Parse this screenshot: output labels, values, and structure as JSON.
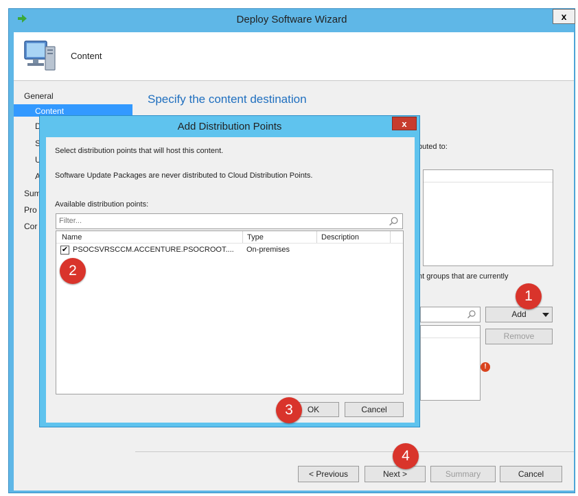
{
  "window": {
    "title": "Deploy Software Wizard",
    "close_label": "x",
    "header_title": "Content"
  },
  "nav": {
    "items": [
      {
        "label": "General"
      },
      {
        "label": "Content"
      },
      {
        "label": "D"
      },
      {
        "label": "S"
      },
      {
        "label": "U"
      },
      {
        "label": "A"
      },
      {
        "label": "Sum"
      },
      {
        "label": "Pro"
      },
      {
        "label": "Cor"
      }
    ]
  },
  "content": {
    "title": "Specify the content destination",
    "partial_text_1": "buted to:",
    "partial_text_2": "nt groups that are currently",
    "add_label": "Add",
    "remove_label": "Remove"
  },
  "footer": {
    "previous_label": "< Previous",
    "next_label": "Next >",
    "summary_label": "Summary",
    "cancel_label": "Cancel"
  },
  "dialog": {
    "title": "Add Distribution Points",
    "close_label": "x",
    "text1": "Select distribution points that will host this content.",
    "text2": "Software Update Packages are never distributed to Cloud Distribution Points.",
    "available_label": "Available distribution points:",
    "filter_placeholder": "Filter...",
    "columns": [
      "Name",
      "Type",
      "Description"
    ],
    "rows": [
      {
        "checked": true,
        "name": "PSOCSVRSCCM.ACCENTURE.PSOCROOT....",
        "type": "On-premises",
        "description": ""
      }
    ],
    "ok_label": "OK",
    "cancel_label": "Cancel"
  },
  "callouts": [
    "1",
    "2",
    "3",
    "4"
  ],
  "colors": {
    "title_blue": "#1f6fbf",
    "selection": "#3399ff",
    "callout_red": "#d9342b",
    "dialog_frame": "#5fc3ee",
    "close_red": "#c73c2d"
  }
}
